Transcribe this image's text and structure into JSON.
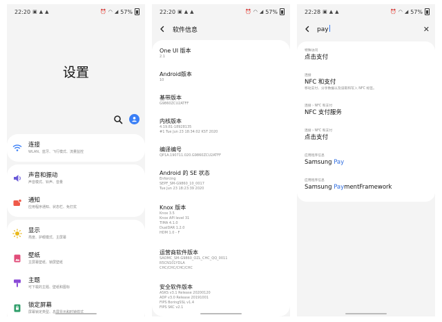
{
  "screen1": {
    "status": {
      "time": "22:20",
      "battery": "57%"
    },
    "title": "设置",
    "items": [
      {
        "title": "连接",
        "subtitle": "WLAN、蓝牙、飞行模式、流量监控",
        "icon": "wifi-icon",
        "color": "#3a7ff6"
      },
      {
        "title": "声音和振动",
        "subtitle": "声音模式、铃声、音量",
        "icon": "sound-icon",
        "color": "#6b5bd8"
      },
      {
        "title": "通知",
        "subtitle": "应用程序通知、状态栏、免打扰",
        "icon": "notification-icon",
        "color": "#ef5a4a"
      },
      {
        "title": "显示",
        "subtitle": "亮度、护眼模式、主屏幕",
        "icon": "display-icon",
        "color": "#e9b81b"
      },
      {
        "title": "壁纸",
        "subtitle": "主屏幕壁纸、锁屏壁纸",
        "icon": "wallpaper-icon",
        "color": "#e14d7a"
      },
      {
        "title": "主题",
        "subtitle": "可下载的主题、壁纸和图标",
        "icon": "theme-icon",
        "color": "#8a4ad6"
      },
      {
        "title": "锁定屏幕",
        "subtitle": "屏幕锁定类型、息屏显示和时钟样式",
        "icon": "lock-screen-icon",
        "color": "#2f9e6a"
      }
    ]
  },
  "screen2": {
    "status": {
      "time": "22:20",
      "battery": "57%"
    },
    "title": "软件信息",
    "items": [
      {
        "label": "One UI 版本",
        "values": [
          "2.1"
        ]
      },
      {
        "label": "Android版本",
        "values": [
          "10"
        ]
      },
      {
        "label": "基带版本",
        "values": [
          "G9860ZCU2ATFF"
        ]
      },
      {
        "label": "内核版本",
        "values": [
          "4.19.81-18928135",
          "#1 Tue Jun 23 18:34:02 KST 2020"
        ]
      },
      {
        "label": "编译编号",
        "values": [
          "QP1A.190711.020.G9860ZCU2ATFF"
        ]
      },
      {
        "label": "Android 的 SE 状态",
        "values": [
          "Enforcing",
          "SEPF_SM-G9860_10_0017",
          "Tue Jun 23 18:23:39 2020"
        ]
      },
      {
        "label": "Knox 版本",
        "values": [
          "Knox 3.5",
          "Knox API level 31",
          "TIMA 4.1.0",
          "DualDAR 1.2.0",
          "HDM 1.0 - F"
        ]
      },
      {
        "label": "运营商软件版本",
        "values": [
          "SAOMC_SM-G9860_OZL_CHC_QQ_0011",
          "R5CN101YDLA",
          "CHC/CHC/CHC/CHC"
        ]
      },
      {
        "label": "安全软件版本",
        "values": [
          "ASKS v3.1 Release 20200120",
          "ADP v3.0 Release 20191001",
          "FIPS BoringSSL v1.4",
          "FIPS SKC v2.1"
        ]
      }
    ]
  },
  "screen3": {
    "status": {
      "time": "22:28",
      "battery": "57%"
    },
    "query": "pay",
    "results": [
      {
        "path": "特殊访问",
        "title": [
          "点击支付"
        ],
        "desc": ""
      },
      {
        "path": "连接",
        "title": [
          "NFC 和支付"
        ],
        "desc": "移动支付、分享数据以及读取和写入 NFC 标签。"
      },
      {
        "path": "连接 › NFC 和支付",
        "title": [
          "NFC 支付服务"
        ],
        "desc": ""
      },
      {
        "path": "连接 › NFC 和支付",
        "title": [
          "点击支付"
        ],
        "desc": ""
      },
      {
        "path": "应用程序信息",
        "title": [
          "Samsung ",
          "Pay"
        ],
        "desc": ""
      },
      {
        "path": "应用程序信息",
        "title": [
          "Samsung ",
          "Pay",
          "mentFramework"
        ],
        "desc": ""
      }
    ]
  }
}
